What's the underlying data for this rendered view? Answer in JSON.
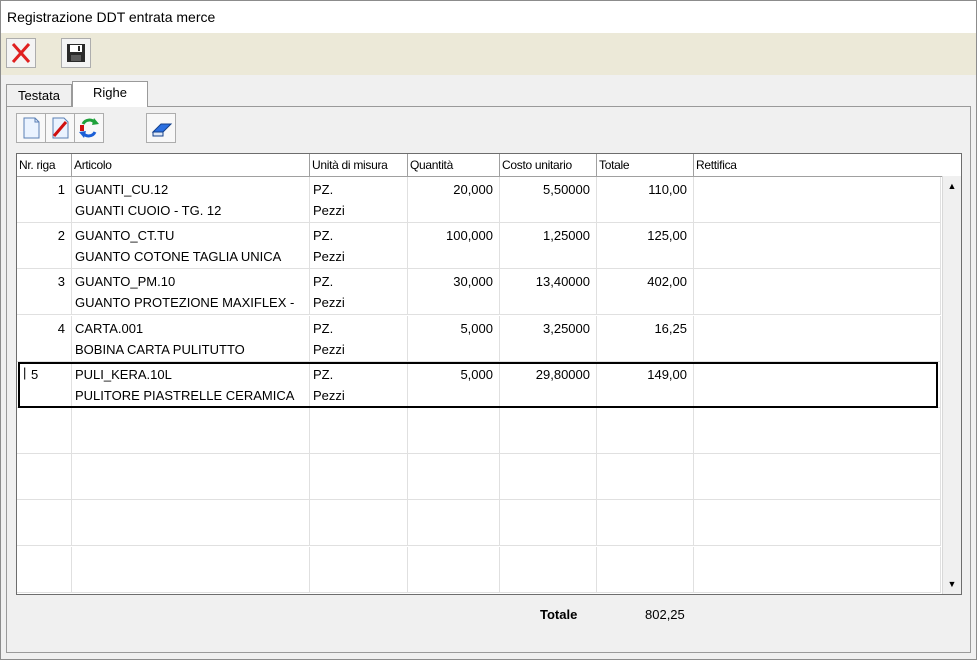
{
  "window": {
    "title": "Registrazione DDT entrata merce"
  },
  "toolbar": {
    "close_icon": "red-x-icon",
    "save_icon": "floppy-disk-icon"
  },
  "tabs": [
    {
      "label": "Testata",
      "active": false
    },
    {
      "label": "Righe",
      "active": true
    }
  ],
  "subtoolbar": {
    "buttons": [
      "new-row-icon",
      "edit-row-icon",
      "refresh-icon",
      "eraser-icon"
    ]
  },
  "grid": {
    "columns": [
      "Nr. riga",
      "Articolo",
      "Unità di misura",
      "Quantità",
      "Costo unitario",
      "Totale",
      "Rettifica"
    ],
    "rows": [
      {
        "nr": "1",
        "code": "GUANTI_CU.12",
        "desc": "GUANTI CUOIO - TG. 12",
        "um_code": "PZ.",
        "um_desc": "Pezzi",
        "qty": "20,000",
        "cost": "5,50000",
        "total": "110,00",
        "rettifica": ""
      },
      {
        "nr": "2",
        "code": "GUANTO_CT.TU",
        "desc": "GUANTO COTONE TAGLIA UNICA",
        "um_code": "PZ.",
        "um_desc": "Pezzi",
        "qty": "100,000",
        "cost": "1,25000",
        "total": "125,00",
        "rettifica": ""
      },
      {
        "nr": "3",
        "code": "GUANTO_PM.10",
        "desc": "GUANTO PROTEZIONE MAXIFLEX -",
        "um_code": "PZ.",
        "um_desc": "Pezzi",
        "qty": "30,000",
        "cost": "13,40000",
        "total": "402,00",
        "rettifica": ""
      },
      {
        "nr": "4",
        "code": "CARTA.001",
        "desc": "BOBINA CARTA PULITUTTO",
        "um_code": "PZ.",
        "um_desc": "Pezzi",
        "qty": "5,000",
        "cost": "3,25000",
        "total": "16,25",
        "rettifica": ""
      },
      {
        "nr": "5",
        "code": "PULI_KERA.10L",
        "desc": "PULITORE PIASTRELLE CERAMICA",
        "um_code": "PZ.",
        "um_desc": "Pezzi",
        "qty": "5,000",
        "cost": "29,80000",
        "total": "149,00",
        "rettifica": ""
      }
    ],
    "selected_row": 5
  },
  "footer": {
    "label": "Totale",
    "value": "802,25"
  }
}
